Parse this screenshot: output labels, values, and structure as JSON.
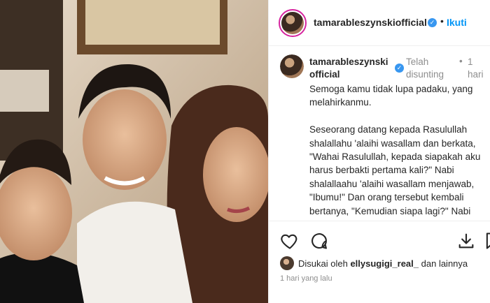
{
  "header": {
    "username": "tamarableszynskiofficial",
    "separator": "•",
    "follow_label": "Ikuti"
  },
  "caption": {
    "username_line1": "tamarableszynski",
    "username_line2": "official",
    "edited_line1": "Telah",
    "edited_line2": "disunting",
    "separator": "•",
    "time_line1": "1",
    "time_line2": "hari",
    "paragraph1": "Semoga kamu tidak lupa padaku, yang melahirkanmu.",
    "paragraph2": "Seseorang datang kepada Rasulullah shalallahu 'alaihi wasallam dan berkata, \"Wahai Rasulullah, kepada siapakah aku harus berbakti pertama kali?\" Nabi shalallaahu 'alaihi wasallam menjawab, \"Ibumu!\" Dan orang tersebut kembali bertanya, \"Kemudian siapa lagi?\" Nabi shalallaahu 'alaihi wasallam menjawab"
  },
  "actions": {
    "icons": [
      "heart-icon",
      "comment-icon",
      "download-icon",
      "bookmark-icon"
    ]
  },
  "likes": {
    "prefix": "Disukai oleh",
    "user": "ellysugigi_real_",
    "suffix": "dan lainnya"
  },
  "timestamp": "1 hari yang lalu",
  "colors": {
    "accent": "#0095f6",
    "verified": "#3897f0",
    "muted": "#8e8e8e"
  }
}
